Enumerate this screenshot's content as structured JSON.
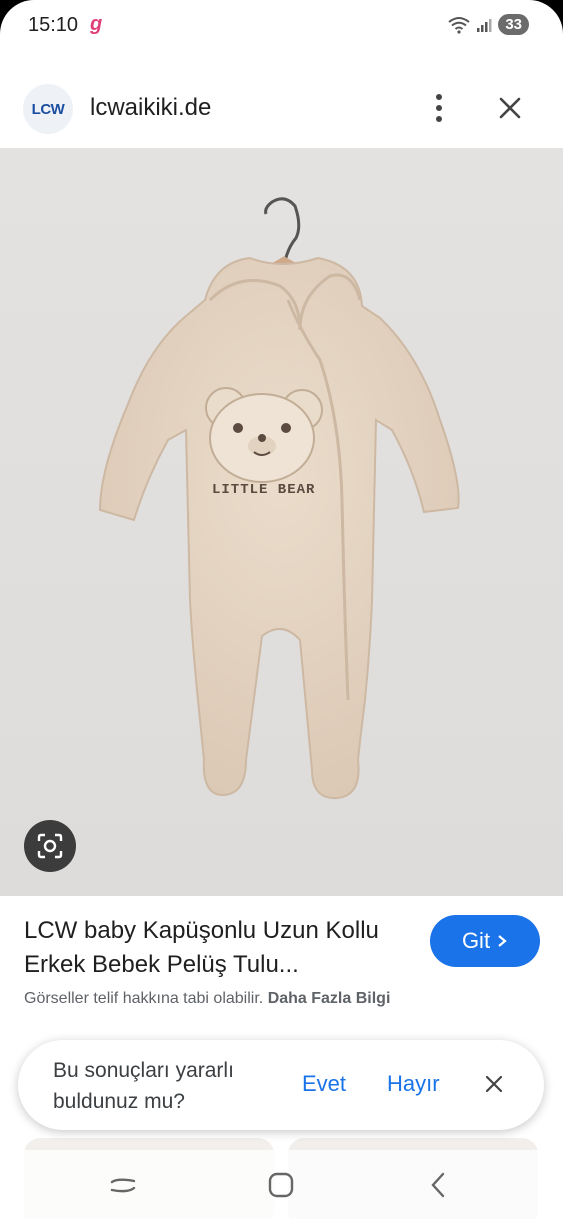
{
  "status_bar": {
    "time": "15:10",
    "notification_glyph": "g",
    "battery": "33",
    "icons": [
      "wifi-icon",
      "signal-icon",
      "battery-icon"
    ]
  },
  "header": {
    "logo_text": "LCW",
    "site": "lcwaikiki.de",
    "icons": [
      "more-vert-icon",
      "close-icon"
    ]
  },
  "image": {
    "print_text": "LITTLE BEAR",
    "lens_icon": "google-lens-icon"
  },
  "result": {
    "title": "LCW baby Kapüşonlu Uzun Kollu Erkek Bebek Pelüş Tulu...",
    "go_label": "Git",
    "copyright": "Görseller telif hakkına tabi olabilir.",
    "more_info": "Daha Fazla Bilgi"
  },
  "feedback": {
    "question": "Bu sonuçları yararlı buldunuz mu?",
    "yes": "Evet",
    "no": "Hayır"
  },
  "nav": {
    "icons": [
      "recents-icon",
      "home-icon",
      "back-icon"
    ]
  },
  "colors": {
    "accent": "#1a73e8",
    "fabric": "#e2d3c2"
  }
}
